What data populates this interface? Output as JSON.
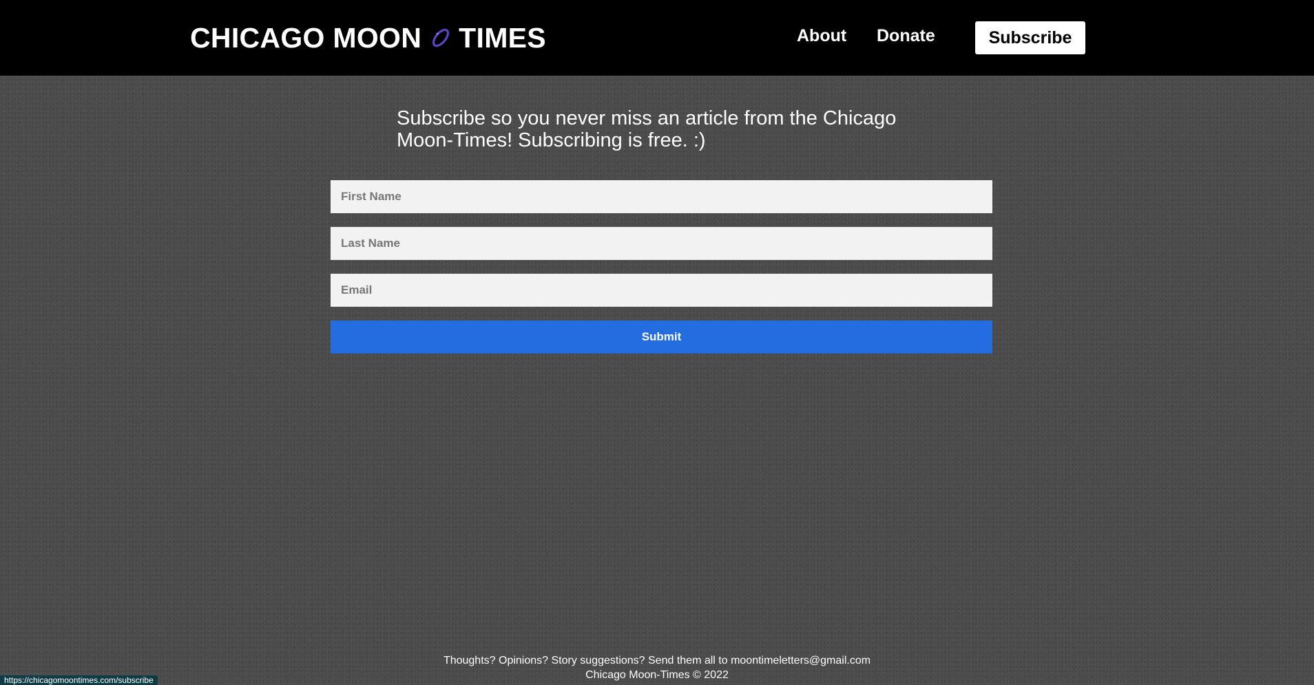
{
  "header": {
    "logo_left": "CHICAGO MOON",
    "logo_right": "TIMES",
    "logo_icon": "planet-icon",
    "nav": {
      "about": "About",
      "donate": "Donate",
      "subscribe": "Subscribe"
    }
  },
  "main": {
    "intro": "Subscribe so you never miss an article from the Chicago Moon-Times! Subscribing is free. :)",
    "form": {
      "first_name_placeholder": "First Name",
      "first_name_value": "",
      "last_name_placeholder": "Last Name",
      "last_name_value": "",
      "email_placeholder": "Email",
      "email_value": "",
      "submit_label": "Submit"
    }
  },
  "footer": {
    "line1": "Thoughts? Opinions? Story suggestions? Send them all to moontimeletters@gmail.com",
    "line2": "Chicago Moon-Times © 2022"
  },
  "status_bar": {
    "url": "https://chicagomoontimes.com/subscribe"
  },
  "colors": {
    "header_bg": "#000000",
    "page_bg": "#4d4d4d",
    "field_bg": "#f2f2f2",
    "submit_bg": "#246de1",
    "planet_accent": "#5b3fb5"
  }
}
